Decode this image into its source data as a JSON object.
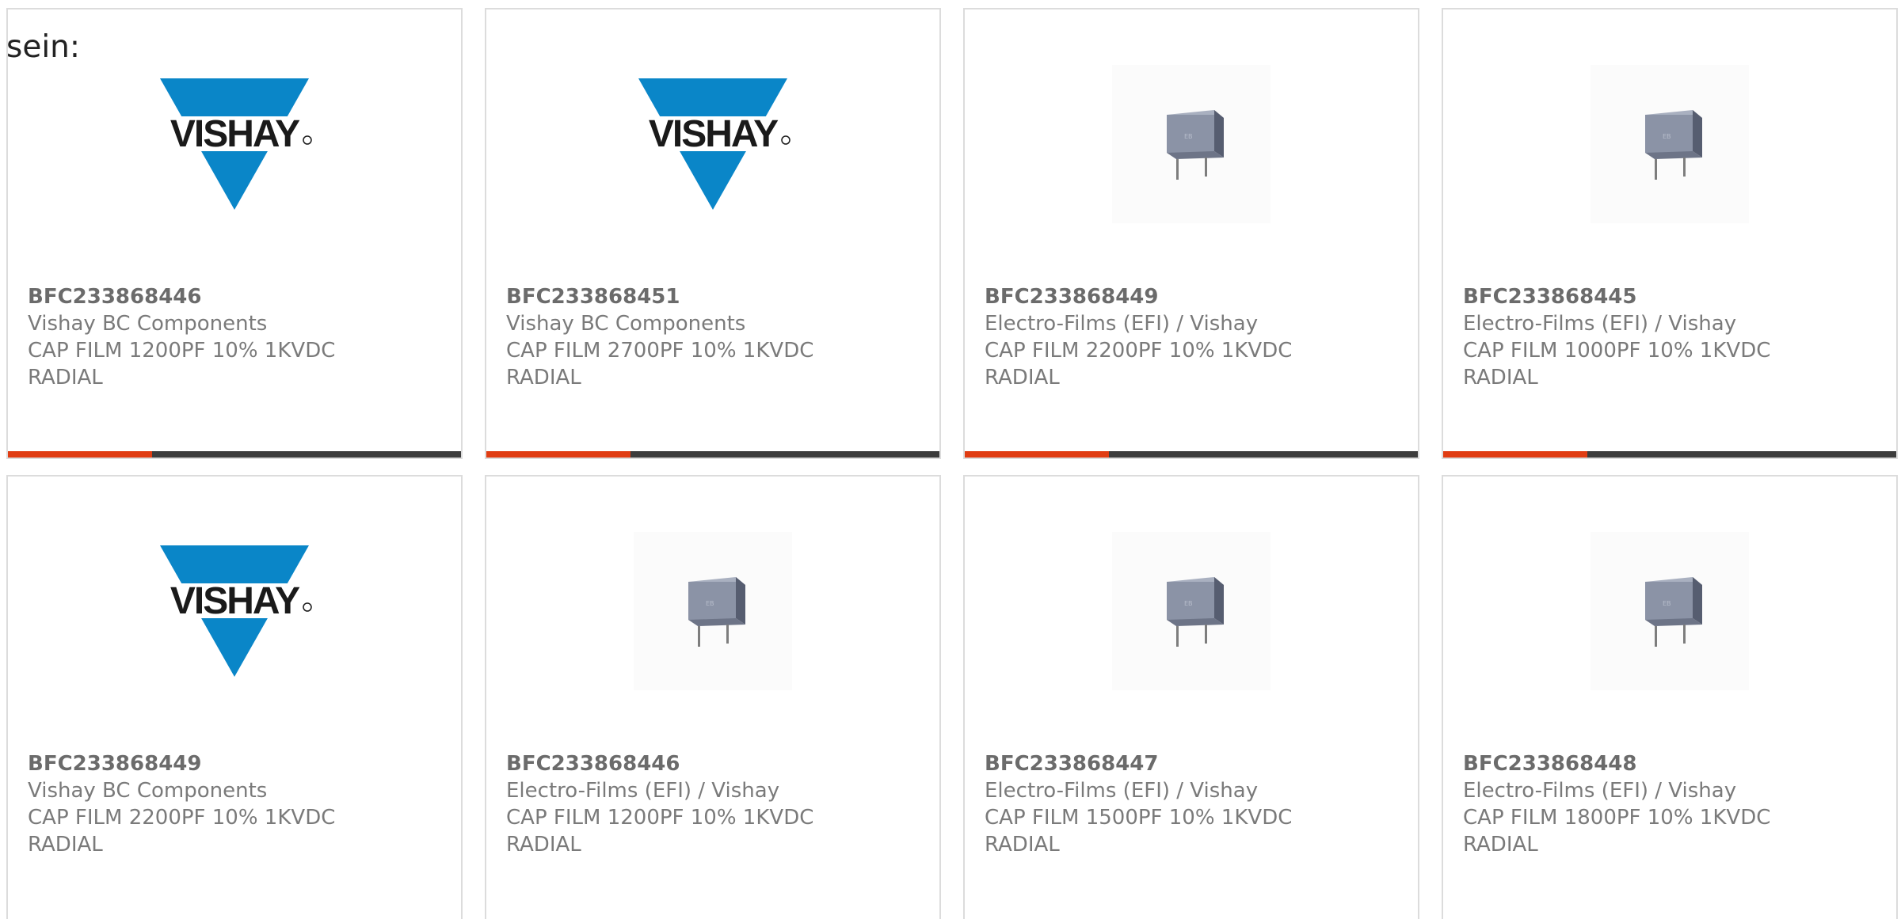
{
  "intro_text": "sein:",
  "colors": {
    "accent": "#e03c12",
    "bar": "#3c3c3c",
    "vishay_blue": "#0a86c8",
    "capacitor": "#8b93a6"
  },
  "products": [
    {
      "part": "BFC233868446",
      "maker": "Vishay BC Components",
      "desc1": "CAP FILM 1200PF 10% 1KVDC",
      "desc2": "RADIAL",
      "image": "vishay-logo"
    },
    {
      "part": "BFC233868451",
      "maker": "Vishay BC Components",
      "desc1": "CAP FILM 2700PF 10% 1KVDC",
      "desc2": "RADIAL",
      "image": "vishay-logo"
    },
    {
      "part": "BFC233868449",
      "maker": "Electro-Films (EFI) / Vishay",
      "desc1": "CAP FILM 2200PF 10% 1KVDC",
      "desc2": "RADIAL",
      "image": "capacitor-photo"
    },
    {
      "part": "BFC233868445",
      "maker": "Electro-Films (EFI) / Vishay",
      "desc1": "CAP FILM 1000PF 10% 1KVDC",
      "desc2": "RADIAL",
      "image": "capacitor-photo"
    },
    {
      "part": "BFC233868449",
      "maker": "Vishay BC Components",
      "desc1": "CAP FILM 2200PF 10% 1KVDC",
      "desc2": "RADIAL",
      "image": "vishay-logo"
    },
    {
      "part": "BFC233868446",
      "maker": "Electro-Films (EFI) / Vishay",
      "desc1": "CAP FILM 1200PF 10% 1KVDC",
      "desc2": "RADIAL",
      "image": "capacitor-photo"
    },
    {
      "part": "BFC233868447",
      "maker": "Electro-Films (EFI) / Vishay",
      "desc1": "CAP FILM 1500PF 10% 1KVDC",
      "desc2": "RADIAL",
      "image": "capacitor-photo"
    },
    {
      "part": "BFC233868448",
      "maker": "Electro-Films (EFI) / Vishay",
      "desc1": "CAP FILM 1800PF 10% 1KVDC",
      "desc2": "RADIAL",
      "image": "capacitor-photo"
    }
  ]
}
